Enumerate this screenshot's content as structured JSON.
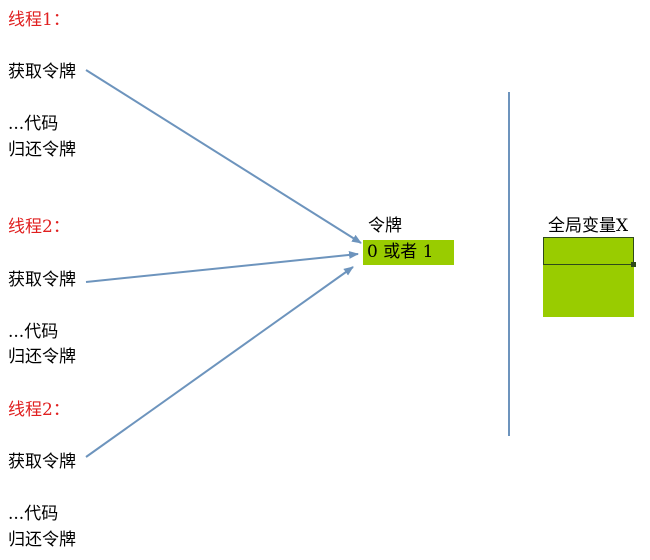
{
  "threads": [
    {
      "title": "线程1：",
      "acquire": "获取令牌",
      "code": "...代码",
      "release": "归还令牌"
    },
    {
      "title": "线程2：",
      "acquire": "获取令牌",
      "code": "...代码",
      "release": "归还令牌"
    },
    {
      "title": "线程2：",
      "acquire": "获取令牌",
      "code": "...代码",
      "release": "归还令牌"
    }
  ],
  "token": {
    "label": "令牌",
    "value": "0 或者 1"
  },
  "global_var": {
    "label": "全局变量X"
  },
  "colors": {
    "thread_title": "#e02020",
    "arrow": "#6d94bd",
    "box_fill": "#99cc00",
    "divider": "#6d94bd"
  }
}
